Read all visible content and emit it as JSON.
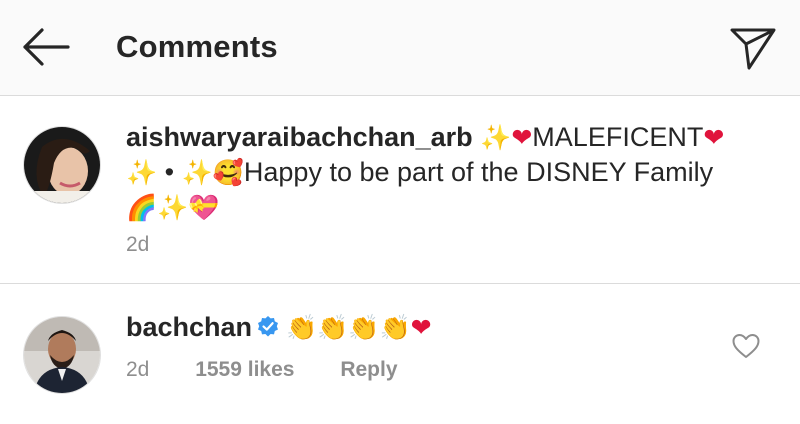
{
  "header": {
    "title": "Comments",
    "back_icon": "arrow-left-icon",
    "send_icon": "paper-plane-icon"
  },
  "comments": [
    {
      "username": "aishwaryaraibachchan_arb",
      "segments": [
        {
          "type": "emoji",
          "icon": "sparkles-emoji",
          "glyph": "✨"
        },
        {
          "type": "emoji",
          "icon": "red-heart-emoji",
          "glyph": "❤"
        },
        {
          "type": "text",
          "value": "MALEFICENT"
        },
        {
          "type": "emoji",
          "icon": "red-heart-emoji",
          "glyph": "❤"
        },
        {
          "type": "emoji",
          "icon": "sparkles-emoji",
          "glyph": "✨"
        },
        {
          "type": "text",
          "value": " • "
        },
        {
          "type": "emoji",
          "icon": "sparkles-emoji",
          "glyph": "✨"
        },
        {
          "type": "emoji",
          "icon": "smiling-face-with-hearts-emoji",
          "glyph": "🥰"
        },
        {
          "type": "text",
          "value": "Happy to be part of the DISNEY Family"
        },
        {
          "type": "emoji",
          "icon": "rainbow-emoji",
          "glyph": "🌈"
        },
        {
          "type": "emoji",
          "icon": "sparkles-emoji",
          "glyph": "✨"
        },
        {
          "type": "emoji",
          "icon": "heart-with-ribbon-emoji",
          "glyph": "💝"
        }
      ],
      "time": "2d"
    },
    {
      "username": "bachchan",
      "verified": true,
      "segments": [
        {
          "type": "emoji",
          "icon": "clapping-hands-emoji",
          "glyph": "👏"
        },
        {
          "type": "emoji",
          "icon": "clapping-hands-emoji",
          "glyph": "👏"
        },
        {
          "type": "emoji",
          "icon": "clapping-hands-emoji",
          "glyph": "👏"
        },
        {
          "type": "emoji",
          "icon": "clapping-hands-emoji",
          "glyph": "👏"
        },
        {
          "type": "emoji",
          "icon": "red-heart-emoji",
          "glyph": "❤"
        }
      ],
      "time": "2d",
      "likes": "1559 likes",
      "reply_label": "Reply"
    }
  ],
  "colors": {
    "text": "#262626",
    "meta": "#8e8e8e",
    "verified_blue": "#3897f0",
    "heart_red": "#e0143c",
    "divider": "#dbdbdb"
  }
}
